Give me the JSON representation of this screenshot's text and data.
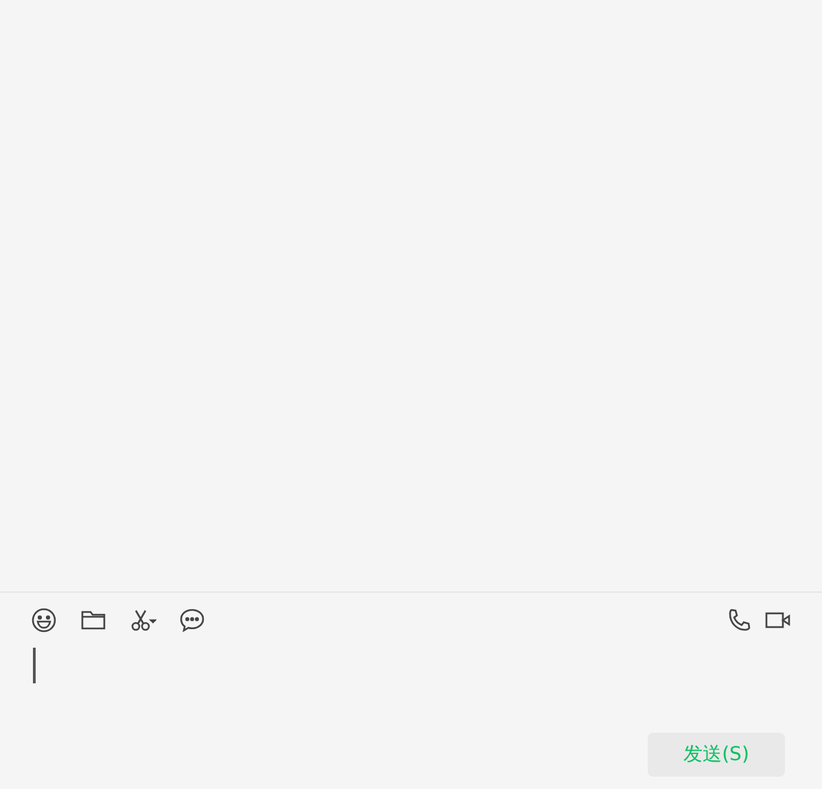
{
  "composer": {
    "send_button": {
      "label": "发送(S)"
    }
  }
}
